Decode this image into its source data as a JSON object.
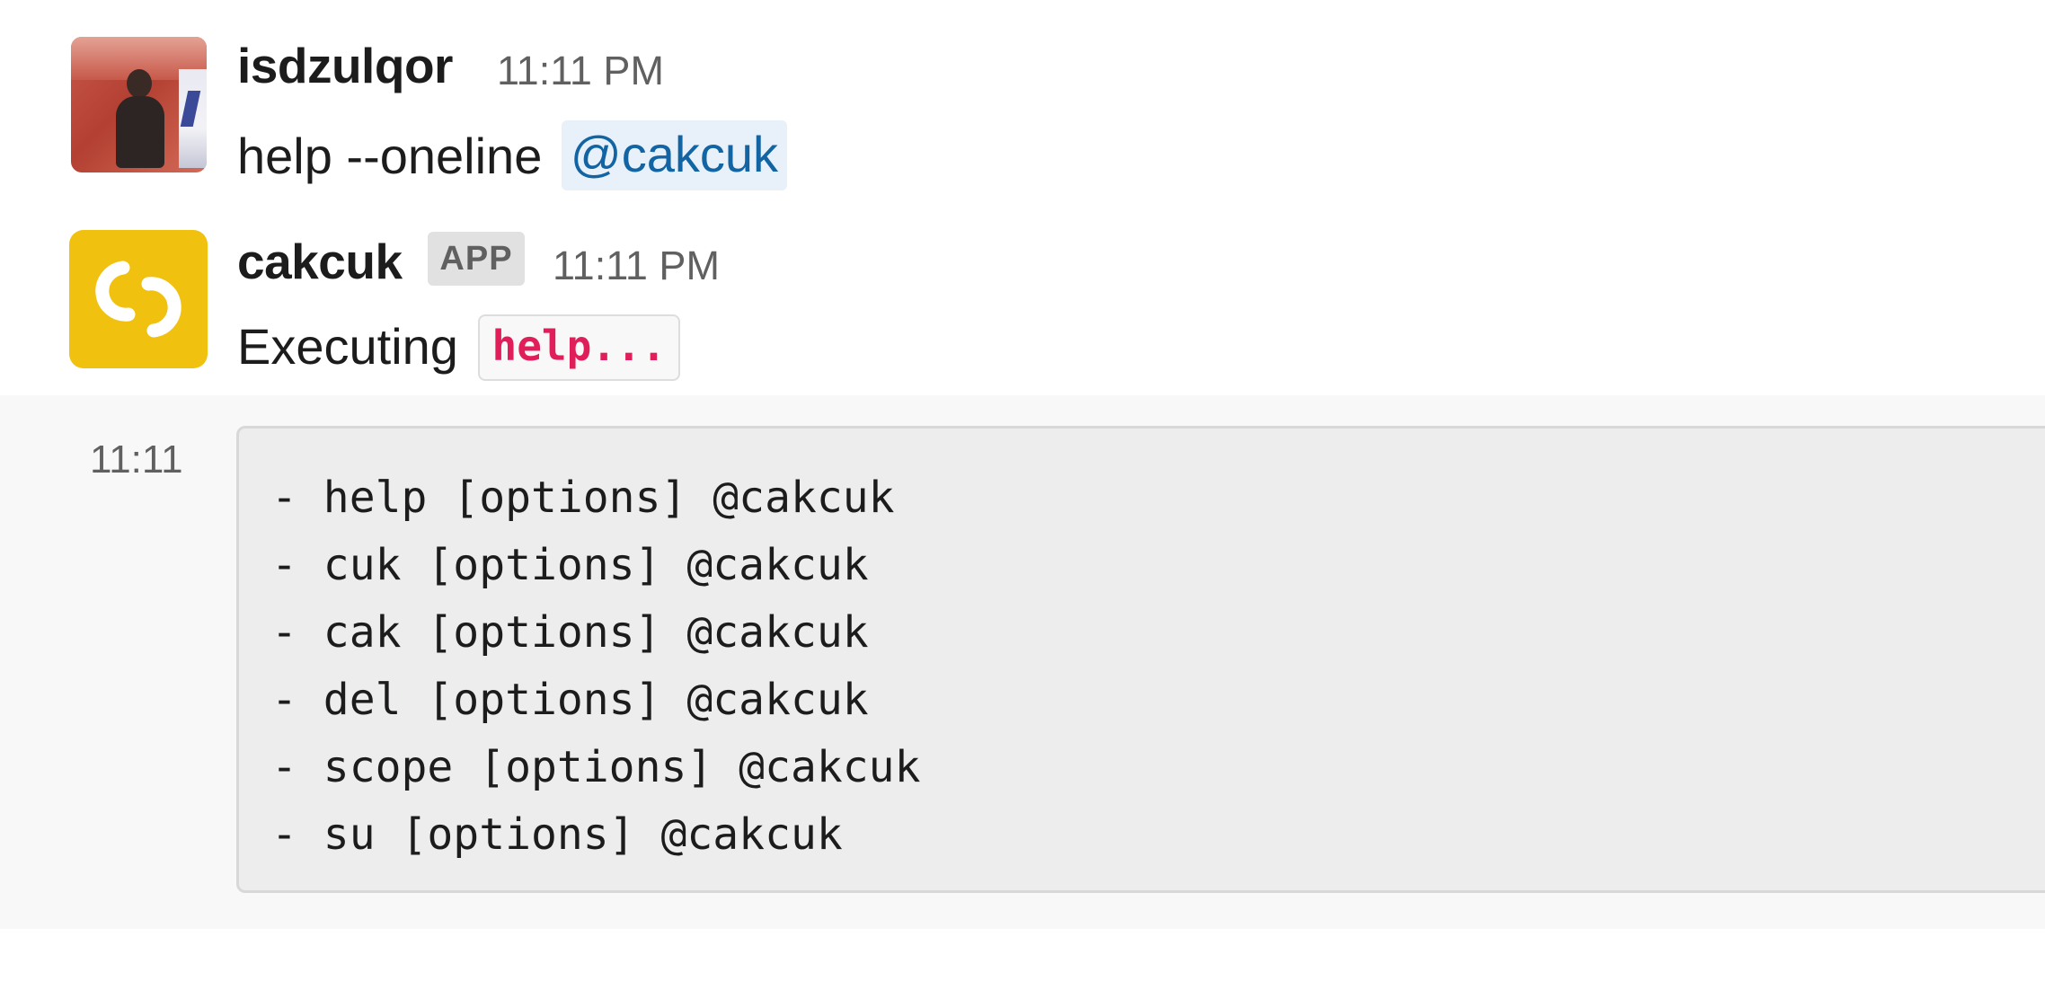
{
  "messages": [
    {
      "author": "isdzulqor",
      "time": "11:11 PM",
      "text": "help --oneline",
      "mention": "@cakcuk"
    },
    {
      "author": "cakcuk",
      "badge": "APP",
      "time": "11:11 PM",
      "text": "Executing",
      "code": "help..."
    }
  ],
  "continuation": {
    "time": "11:11",
    "code_lines": [
      "- help [options] @cakcuk",
      "- cuk [options] @cakcuk",
      "- cak [options] @cakcuk",
      "- del [options] @cakcuk",
      "- scope [options] @cakcuk",
      "- su [options] @cakcuk"
    ]
  },
  "colors": {
    "mention_bg": "#e8f1fa",
    "mention_text": "#1264a3",
    "code_text": "#e01e5a",
    "bot_avatar_bg": "#f1c110"
  },
  "icons": {
    "bot_avatar": "chain-link-icon"
  }
}
